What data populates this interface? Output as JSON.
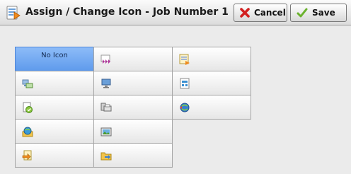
{
  "window": {
    "title": "Assign / Change Icon - Job Number 1",
    "title_icon": "assign-icon-icon"
  },
  "toolbar": {
    "cancel_label": "Cancel",
    "cancel_icon": "red-x-icon",
    "save_label": "Save",
    "save_icon": "green-check-icon"
  },
  "icon_grid": {
    "selected_label": "No Icon",
    "options": [
      "no-icon",
      "purple-arrows-icon",
      "document-share-icon",
      "folder-transfer-icon",
      "computer-icon",
      "document-list-icon",
      "approved-document-icon",
      "fax-printer-icon",
      "globe-arrows-icon",
      "globe-folder-icon",
      "image-scan-icon",
      "document-arrow-icon",
      "folder-arrow-icon"
    ]
  },
  "colors": {
    "selected_fill": "#6fa8f2",
    "title_bar": "#e6e6e6",
    "cancel_icon": "#d22020",
    "save_icon": "#6bb22e"
  }
}
